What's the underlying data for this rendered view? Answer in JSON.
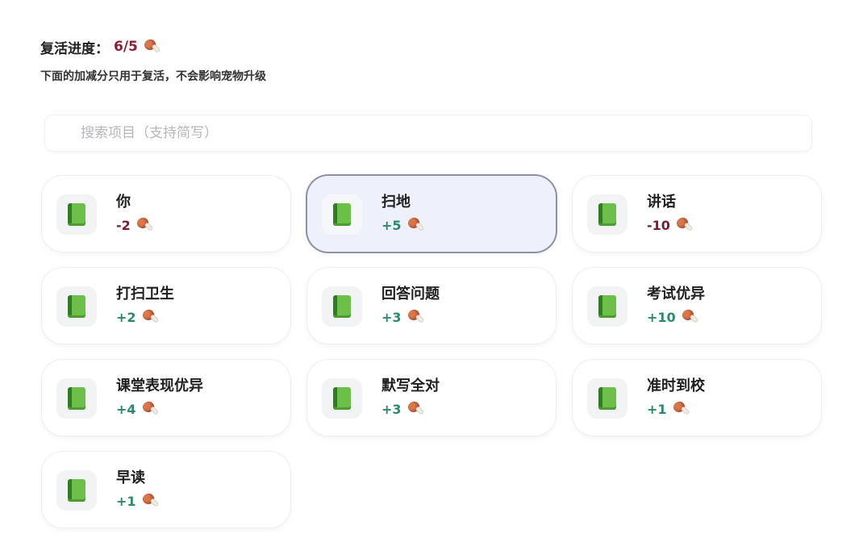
{
  "header": {
    "progress_label": "复活进度：",
    "progress_value": "6/5",
    "subtitle": "下面的加减分只用于复活，不会影响宠物升级",
    "reward_icon": "drumstick-icon"
  },
  "search": {
    "placeholder": "搜索项目（支持简写）",
    "value": ""
  },
  "items": [
    {
      "title": "你",
      "score": "-2",
      "selected": false,
      "icon": "green-book-icon"
    },
    {
      "title": "扫地",
      "score": "+5",
      "selected": true,
      "icon": "green-book-icon"
    },
    {
      "title": "讲话",
      "score": "-10",
      "selected": false,
      "icon": "green-book-icon"
    },
    {
      "title": "打扫卫生",
      "score": "+2",
      "selected": false,
      "icon": "green-book-icon"
    },
    {
      "title": "回答问题",
      "score": "+3",
      "selected": false,
      "icon": "green-book-icon"
    },
    {
      "title": "考试优异",
      "score": "+10",
      "selected": false,
      "icon": "green-book-icon"
    },
    {
      "title": "课堂表现优异",
      "score": "+4",
      "selected": false,
      "icon": "green-book-icon"
    },
    {
      "title": "默写全对",
      "score": "+3",
      "selected": false,
      "icon": "green-book-icon"
    },
    {
      "title": "准时到校",
      "score": "+1",
      "selected": false,
      "icon": "green-book-icon"
    },
    {
      "title": "早读",
      "score": "+1",
      "selected": false,
      "icon": "green-book-icon"
    }
  ],
  "colors": {
    "negative": "#7b1d2e",
    "positive": "#2b8a6a",
    "progress": "#8b1f33",
    "selected_bg": "#eef1fb",
    "selected_border": "#8d92a3"
  }
}
